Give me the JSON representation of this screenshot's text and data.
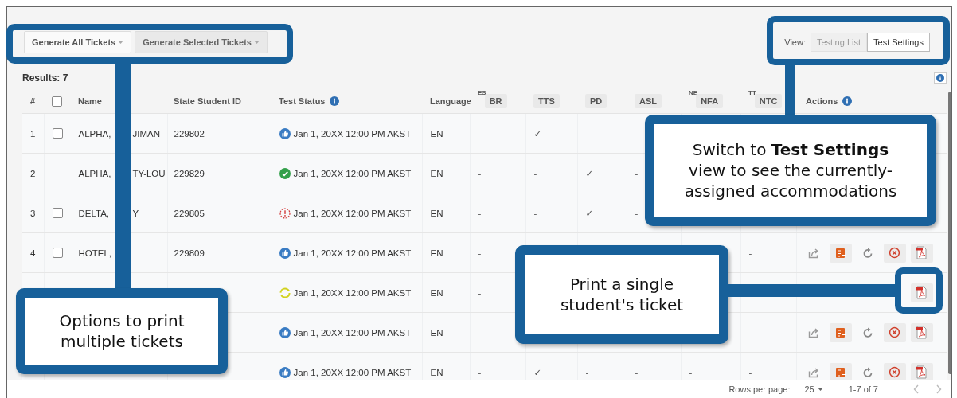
{
  "toolbar": {
    "buttons": [
      {
        "label": "Generate All Tickets",
        "disabled": false
      },
      {
        "label": "Generate Selected Tickets",
        "disabled": true
      }
    ],
    "view": {
      "label": "View:",
      "options": [
        {
          "label": "Testing List",
          "selected": false
        },
        {
          "label": "Test Settings",
          "selected": true
        }
      ]
    }
  },
  "results": "Results: 7",
  "table": {
    "select_all": {
      "checked": false
    },
    "columns": {
      "num": "#",
      "name": "Name",
      "student_id": "State Student ID",
      "status": "Test Status",
      "language": "Language",
      "accommodations": [
        {
          "label": "BR",
          "superscript": "ES"
        },
        {
          "label": "TTS"
        },
        {
          "label": "PD"
        },
        {
          "label": "ASL"
        },
        {
          "label": "NFA",
          "superscript": "NE"
        },
        {
          "label": "NTC",
          "superscript": "TT"
        }
      ],
      "actions": "Actions"
    },
    "rows": [
      {
        "num": "1",
        "checked": false,
        "name": [
          "ALPHA,",
          "JIMAN"
        ],
        "student_id": "229802",
        "status": {
          "kind": "thumb",
          "text": "Jan 1, 20XX 12:00 PM AKST"
        },
        "language": "EN",
        "acc": {
          "br": "-",
          "tts": "✓",
          "pd": "-",
          "asl": "-"
        }
      },
      {
        "num": "2",
        "name": [
          "ALPHA,",
          "TY-LOU"
        ],
        "student_id": "229829",
        "status": {
          "kind": "done",
          "text": "Jan 1, 20XX 12:00 PM AKST"
        },
        "language": "EN",
        "acc": {
          "br": "-",
          "tts": "-",
          "pd": "✓",
          "asl": "-"
        }
      },
      {
        "num": "3",
        "checked": false,
        "name": [
          "DELTA,",
          "Y"
        ],
        "student_id": "229805",
        "status": {
          "kind": "alert",
          "text": "Jan 1, 20XX 12:00 PM AKST"
        },
        "language": "EN",
        "acc": {
          "br": "-",
          "tts": "-",
          "pd": "✓",
          "asl": "-"
        }
      },
      {
        "num": "4",
        "checked": false,
        "name": [
          "HOTEL,"
        ],
        "student_id": "229809",
        "status": {
          "kind": "thumb",
          "text": "Jan 1, 20XX 12:00 PM AKST"
        },
        "language": "EN",
        "acc": {
          "br": "-",
          "ntc": "-"
        },
        "actions": [
          {
            "kind": "share"
          },
          {
            "kind": "edit"
          },
          {
            "kind": "reset"
          },
          {
            "kind": "cancel"
          },
          {
            "kind": "pdf"
          }
        ]
      },
      {
        "status": {
          "kind": "progress",
          "text": "Jan 1, 20XX 12:00 PM AKST"
        },
        "language": "EN",
        "acc": {
          "br": "-"
        },
        "actions": [
          {
            "kind": "pdf"
          }
        ]
      },
      {
        "status": {
          "kind": "thumb",
          "text": "Jan 1, 20XX 12:00 PM AKST"
        },
        "language": "EN",
        "acc": {
          "br": "-",
          "ntc": "-"
        },
        "actions": [
          {
            "kind": "share"
          },
          {
            "kind": "edit"
          },
          {
            "kind": "reset"
          },
          {
            "kind": "cancel"
          },
          {
            "kind": "pdf"
          }
        ]
      },
      {
        "status": {
          "kind": "thumb",
          "text": "Jan 1, 20XX 12:00 PM AKST"
        },
        "language": "EN",
        "acc": {
          "br": "-",
          "tts": "✓",
          "pd": "-",
          "asl": "-",
          "nfa": "-",
          "ntc": "-"
        },
        "actions": [
          {
            "kind": "share"
          },
          {
            "kind": "edit"
          },
          {
            "kind": "reset"
          },
          {
            "kind": "cancel"
          },
          {
            "kind": "pdf"
          }
        ]
      }
    ]
  },
  "pagination": {
    "rows_per_page_label": "Rows per page:",
    "rows_per_page": "25",
    "range": "1-7 of 7"
  },
  "callouts": [
    "Options to print multiple tickets",
    "Switch to **Test Settings** view to see the currently-assigned accommodations",
    "Print a single student's ticket"
  ]
}
